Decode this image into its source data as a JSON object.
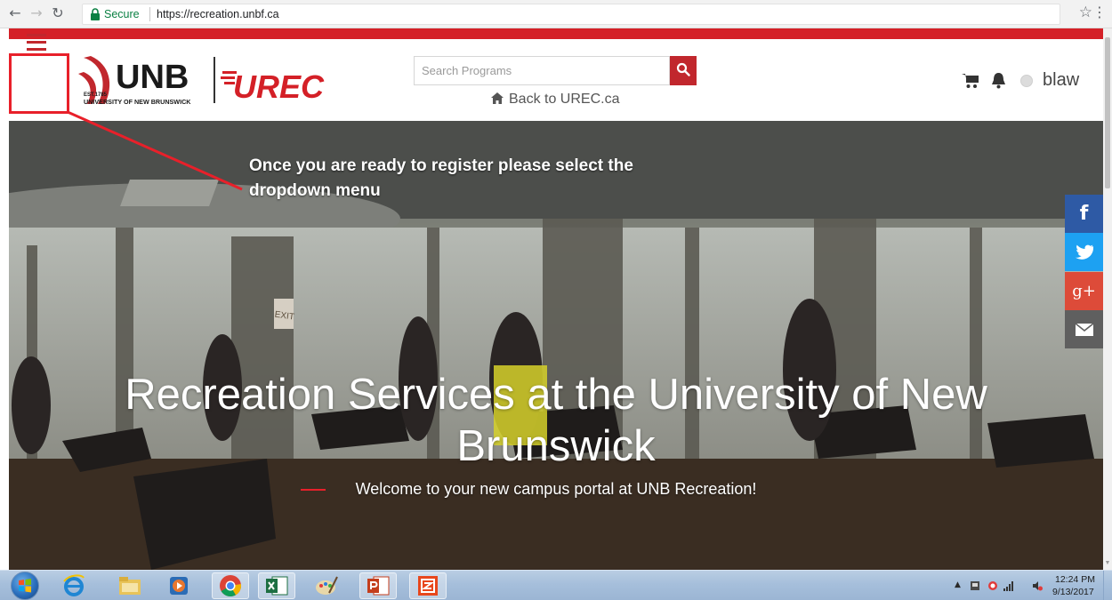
{
  "browser": {
    "secure_label": "Secure",
    "url": "https://recreation.unbf.ca"
  },
  "header": {
    "logo_unb": {
      "text": "UNB",
      "est": "EST.1785",
      "subtitle": "UNIVERSITY OF NEW BRUNSWICK"
    },
    "logo_urec": "UREC",
    "search": {
      "placeholder": "Search Programs"
    },
    "back_link": "Back to UREC.ca",
    "username": "blaw"
  },
  "annotation": {
    "text": "Once you are ready to register please select the dropdown menu"
  },
  "hero": {
    "title": "Recreation Services at the University of New Brunswick",
    "subtitle": "Welcome to your new campus portal at UNB Recreation!",
    "sign": "EXIT"
  },
  "social": [
    "facebook-icon",
    "twitter-icon",
    "google-plus-icon",
    "email-icon"
  ],
  "taskbar": {
    "apps": [
      "internet-explorer-icon",
      "file-explorer-icon",
      "media-player-icon",
      "chrome-icon",
      "excel-icon",
      "paint-icon",
      "powerpoint-icon",
      "app-icon"
    ],
    "clock_time": "12:24 PM",
    "clock_date": "9/13/2017"
  },
  "colors": {
    "brand_red": "#c1272d",
    "facebook": "#2e5aa5",
    "twitter": "#1da1f2",
    "google_plus": "#dd4b39",
    "email": "#5f5f5f"
  }
}
